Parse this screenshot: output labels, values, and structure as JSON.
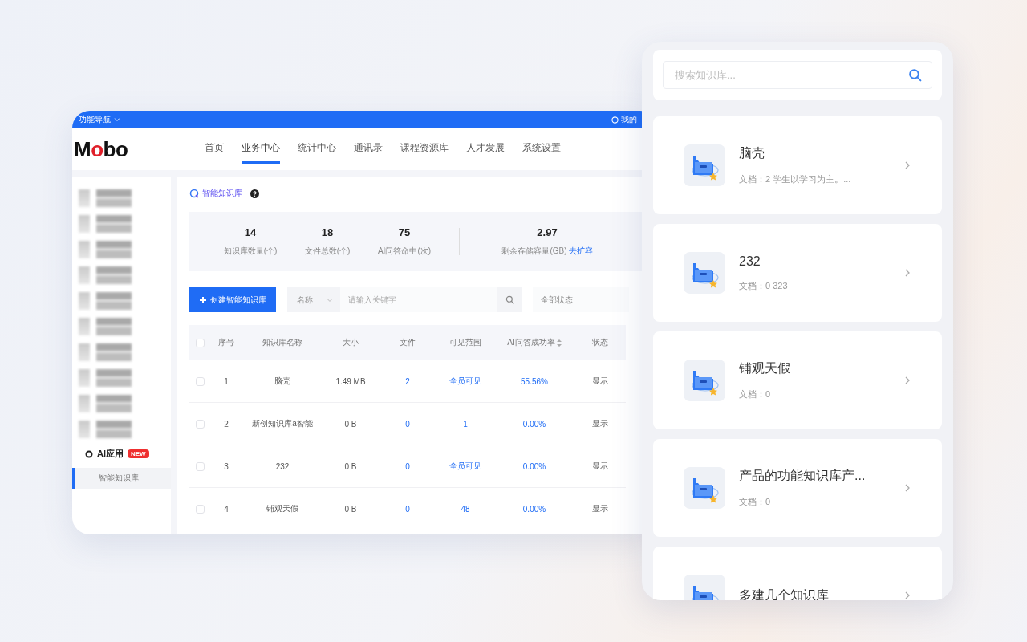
{
  "top_bar": {
    "menu_label": "功能导航",
    "user_label": "我的"
  },
  "logo": [
    {
      "text": "M",
      "accent": false
    },
    {
      "text": "o",
      "accent": true
    },
    {
      "text": "bo",
      "accent": false
    }
  ],
  "nav": [
    {
      "label": "首页",
      "selected": false
    },
    {
      "label": "业务中心",
      "selected": true
    },
    {
      "label": "统计中心",
      "selected": false
    },
    {
      "label": "通讯录",
      "selected": false
    },
    {
      "label": "课程资源库",
      "selected": false
    },
    {
      "label": "人才发展",
      "selected": false
    },
    {
      "label": "系统设置",
      "selected": false
    }
  ],
  "sidebar": {
    "items": [
      {
        "kind": "blurred"
      },
      {
        "kind": "blurred"
      },
      {
        "kind": "blurred"
      },
      {
        "kind": "blurred"
      },
      {
        "kind": "blurred"
      },
      {
        "kind": "blurred"
      },
      {
        "kind": "blurred"
      },
      {
        "kind": "blurred"
      },
      {
        "kind": "blurred"
      },
      {
        "kind": "blurred"
      },
      {
        "kind": "group",
        "label": "AI应用",
        "badge": "NEW",
        "children": [
          {
            "label": "智能知识库",
            "selected": true
          }
        ]
      }
    ]
  },
  "page": {
    "title": "智能知识库"
  },
  "stats": {
    "primary": [
      {
        "value": "14",
        "label": "知识库数量(个)"
      },
      {
        "value": "18",
        "label": "文件总数(个)"
      },
      {
        "value": "75",
        "label": "AI问答命中(次)"
      }
    ],
    "storage": {
      "value": "2.97",
      "label": "剩余存储容量(GB)",
      "link": "去扩容"
    }
  },
  "toolbar": {
    "create_button": "创建智能知识库",
    "field_select": "名称",
    "search_placeholder": "请输入关键字",
    "status_select": "全部状态"
  },
  "table": {
    "header_checked": false,
    "columns": [
      {
        "label": "序号",
        "kind": "text",
        "sortable": false
      },
      {
        "label": "知识库名称",
        "kind": "text",
        "sortable": false
      },
      {
        "label": "大小",
        "kind": "text",
        "sortable": false
      },
      {
        "label": "文件",
        "kind": "link",
        "sortable": false
      },
      {
        "label": "可见范围",
        "kind": "link",
        "sortable": false
      },
      {
        "label": "AI问答成功率",
        "kind": "link",
        "sortable": true
      },
      {
        "label": "状态",
        "kind": "text",
        "sortable": false
      }
    ],
    "rows": [
      {
        "checked": false,
        "cells": [
          "1",
          "脑壳",
          "1.49 MB",
          "2",
          "全员可见",
          "55.56%",
          "显示"
        ]
      },
      {
        "checked": false,
        "cells": [
          "2",
          "新创知识库a智能",
          "0 B",
          "0",
          "1",
          "0.00%",
          "显示"
        ]
      },
      {
        "checked": false,
        "cells": [
          "3",
          "232",
          "0 B",
          "0",
          "全员可见",
          "0.00%",
          "显示"
        ]
      },
      {
        "checked": false,
        "cells": [
          "4",
          "铺观天假",
          "0 B",
          "0",
          "48",
          "0.00%",
          "显示"
        ]
      }
    ]
  },
  "mobile": {
    "search_placeholder": "搜索知识库...",
    "cards": [
      {
        "title": "脑壳",
        "description": "文档：2 学生以学习为主。..."
      },
      {
        "title": "232",
        "description": "文档：0 323"
      },
      {
        "title": "铺观天假",
        "description": "文档：0"
      },
      {
        "title": "产品的功能知识库产...",
        "description": "文档：0"
      },
      {
        "title": "多建几个知识库"
      }
    ]
  }
}
